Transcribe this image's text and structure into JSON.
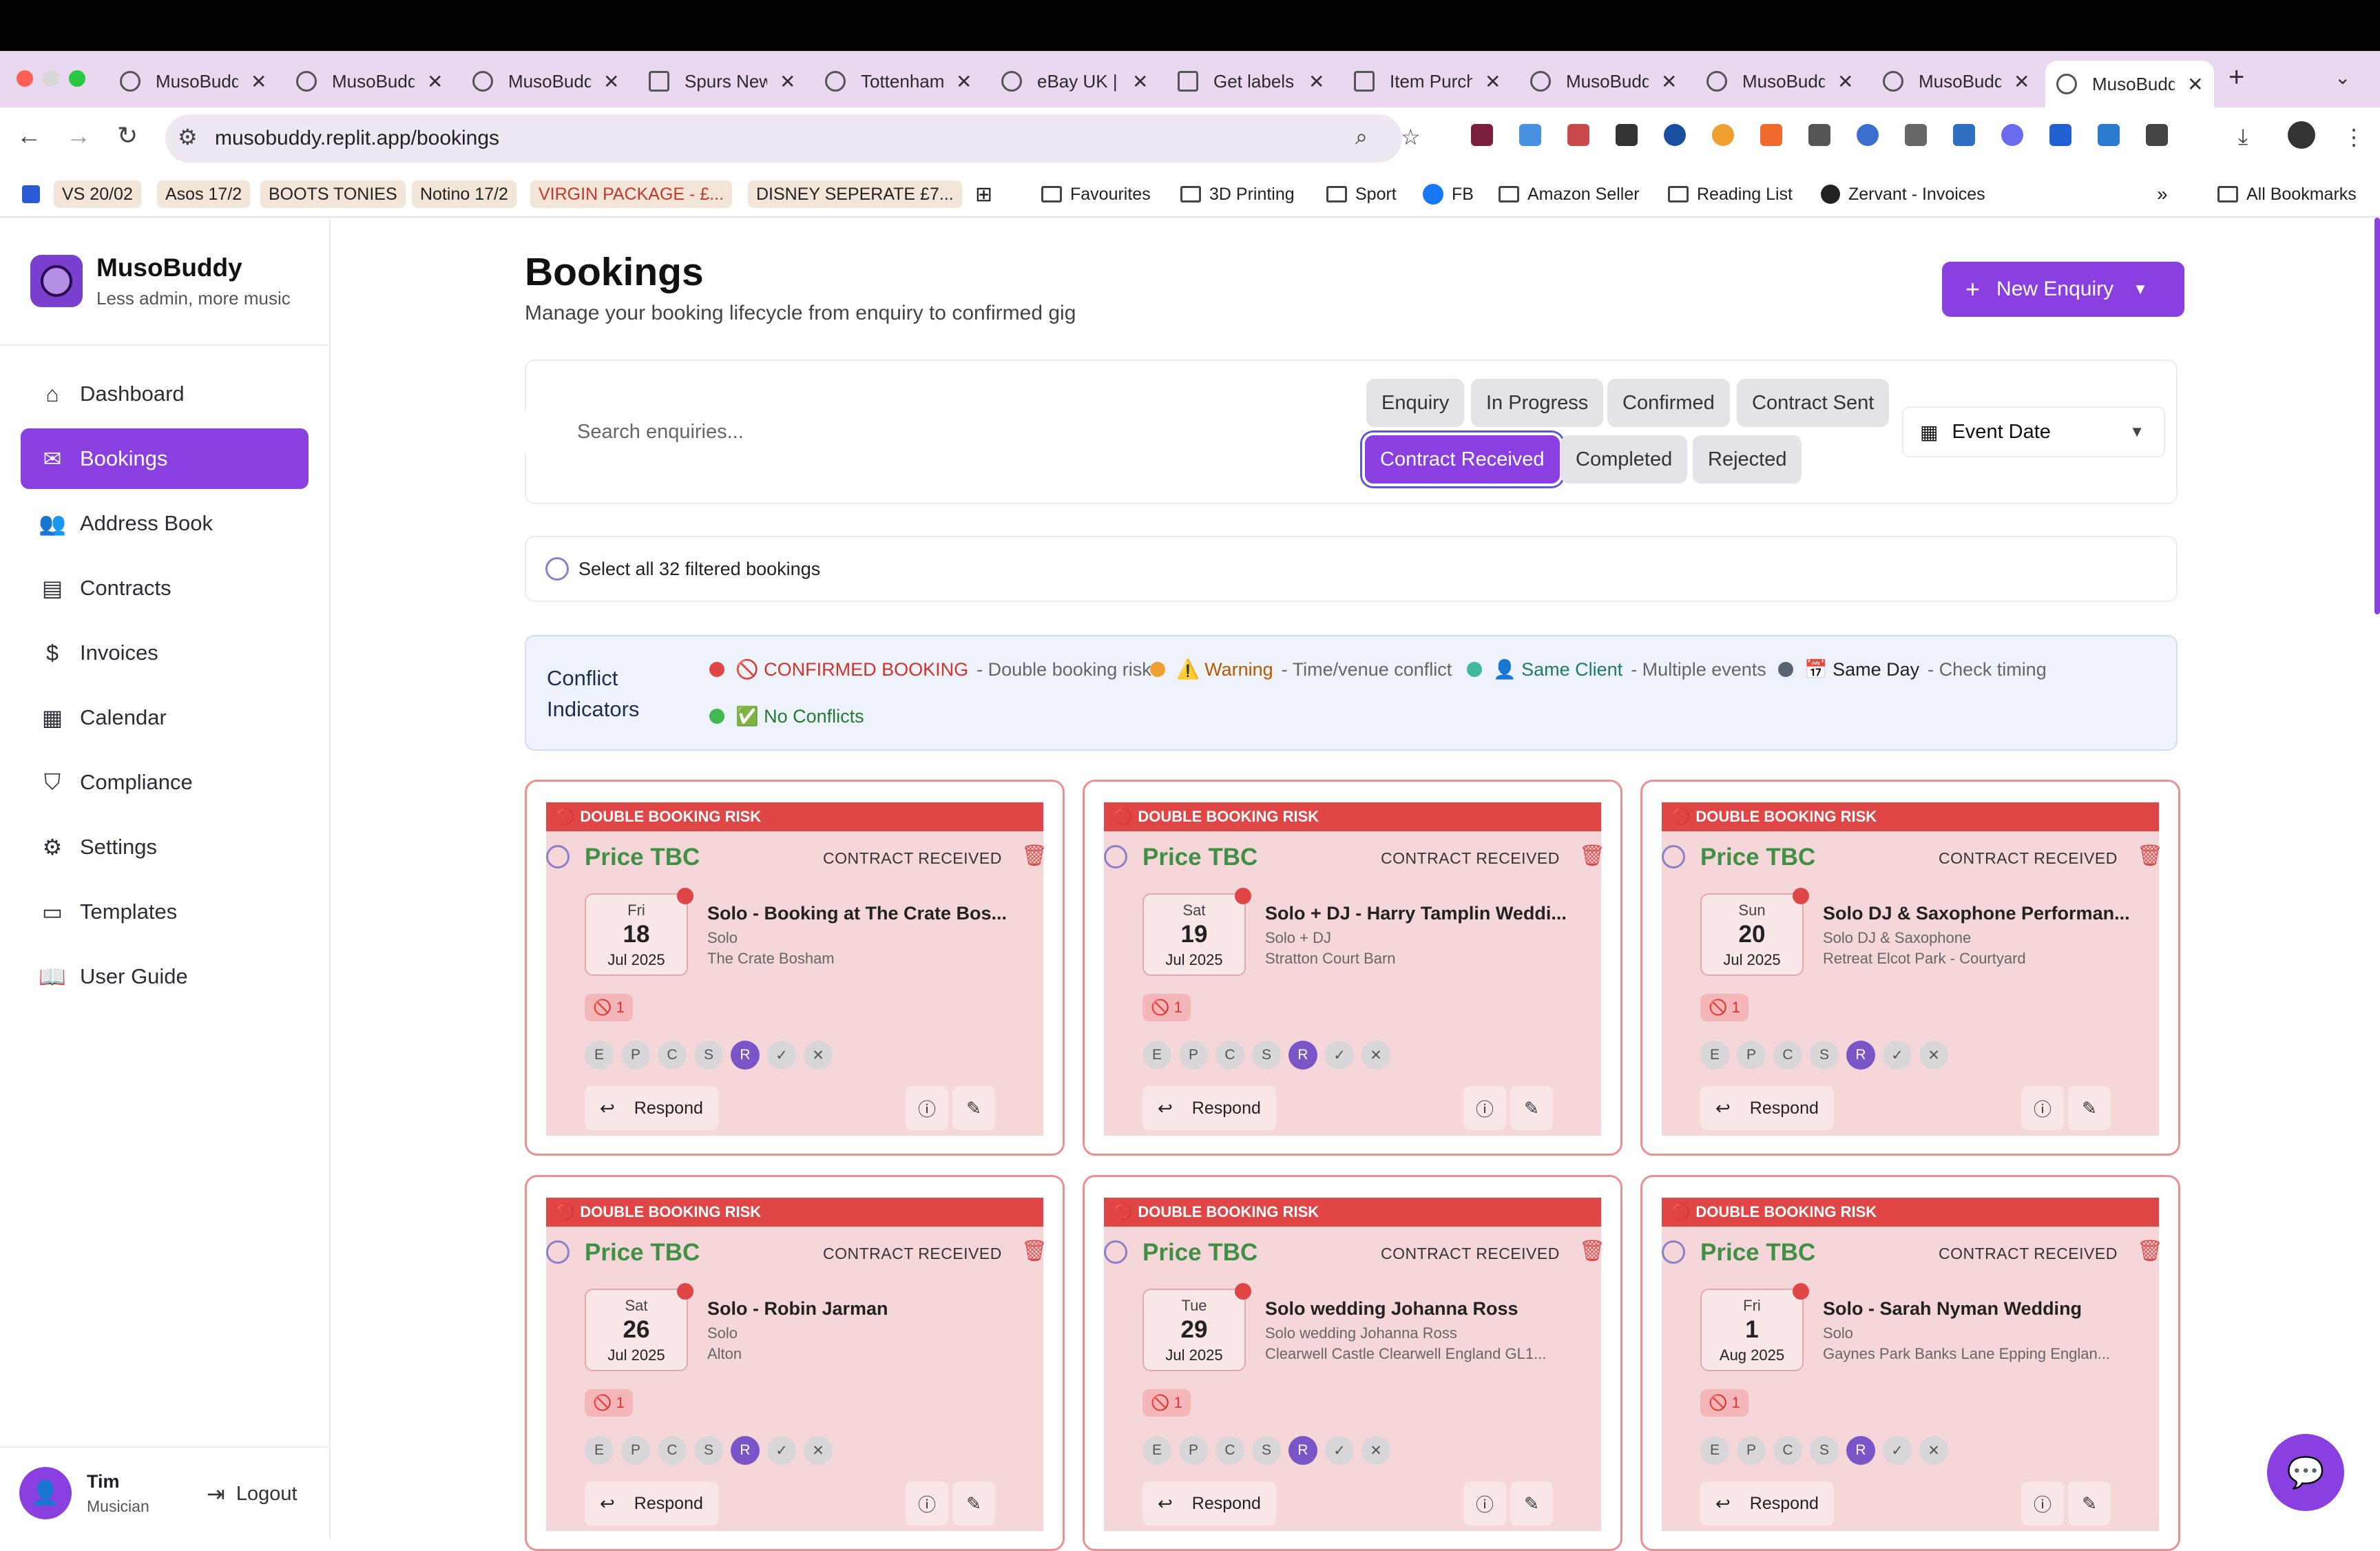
{
  "browser": {
    "tabs": [
      {
        "title": "MusoBuddy"
      },
      {
        "title": "MusoBuddy"
      },
      {
        "title": "MusoBuddy"
      },
      {
        "title": "Spurs News"
      },
      {
        "title": "Tottenham"
      },
      {
        "title": "eBay UK |"
      },
      {
        "title": "Get labels"
      },
      {
        "title": "Item Purch"
      },
      {
        "title": "MusoBuddy"
      },
      {
        "title": "MusoBuddy"
      },
      {
        "title": "MusoBuddy"
      },
      {
        "title": "MusoBuddy"
      }
    ],
    "url": "musobuddy.replit.app/bookings",
    "bookmarks": [
      "VS 20/02",
      "Asos 17/2",
      "BOOTS TONIES",
      "Notino 17/2",
      "VIRGIN PACKAGE - £...",
      "DISNEY SEPERATE £7...",
      "Favourites",
      "3D Printing",
      "Sport",
      "FB",
      "Amazon Seller",
      "Reading List",
      "Zervant - Invoices",
      "All Bookmarks"
    ]
  },
  "app": {
    "name": "MusoBuddy",
    "tagline": "Less admin, more music"
  },
  "nav": [
    {
      "label": "Dashboard",
      "icon": "home-icon"
    },
    {
      "label": "Bookings",
      "icon": "inbox-icon"
    },
    {
      "label": "Address Book",
      "icon": "users-icon"
    },
    {
      "label": "Contracts",
      "icon": "file-icon"
    },
    {
      "label": "Invoices",
      "icon": "dollar-icon"
    },
    {
      "label": "Calendar",
      "icon": "calendar-icon"
    },
    {
      "label": "Compliance",
      "icon": "shield-icon"
    },
    {
      "label": "Settings",
      "icon": "gear-icon"
    },
    {
      "label": "Templates",
      "icon": "message-icon"
    },
    {
      "label": "User Guide",
      "icon": "book-icon"
    }
  ],
  "user": {
    "name": "Tim",
    "role": "Musician",
    "logout": "Logout"
  },
  "page": {
    "title": "Bookings",
    "subtitle": "Manage your booking lifecycle from enquiry to confirmed gig",
    "new_button": "New Enquiry"
  },
  "filters": {
    "search_placeholder": "Search enquiries...",
    "chips": [
      "Enquiry",
      "In Progress",
      "Confirmed",
      "Contract Sent",
      "Contract Received",
      "Completed",
      "Rejected"
    ],
    "active_chip": "Contract Received",
    "sort": "Event Date",
    "select_all": "Select all 32 filtered bookings"
  },
  "conflicts": {
    "title": "Conflict Indicators",
    "items": [
      {
        "label": "🚫 CONFIRMED BOOKING",
        "desc": "- Double booking risk",
        "color": "#e04646"
      },
      {
        "label": "⚠️ Warning",
        "desc": "- Time/venue conflict",
        "color": "#f0a030"
      },
      {
        "label": "👤 Same Client",
        "desc": "- Multiple events",
        "color": "#3fb8a0"
      },
      {
        "label": "📅 Same Day",
        "desc": "- Check timing",
        "color": "#5a6473"
      },
      {
        "label": "✅ No Conflicts",
        "desc": "",
        "color": "#3fb84f"
      }
    ]
  },
  "card_labels": {
    "risk": "DOUBLE BOOKING RISK",
    "price": "Price TBC",
    "status": "CONTRACT RECEIVED",
    "conflict_count": "🚫 1",
    "respond": "Respond",
    "stages": [
      "E",
      "P",
      "C",
      "S",
      "R",
      "✓",
      "✕"
    ]
  },
  "bookings": [
    {
      "dow": "Fri",
      "day": "18",
      "month_year": "Jul 2025",
      "title": "Solo - Booking at The Crate Bos...",
      "type": "Solo",
      "venue": "The Crate Bosham"
    },
    {
      "dow": "Sat",
      "day": "19",
      "month_year": "Jul 2025",
      "title": "Solo + DJ - Harry Tamplin Weddi...",
      "type": "Solo + DJ",
      "venue": "Stratton Court Barn"
    },
    {
      "dow": "Sun",
      "day": "20",
      "month_year": "Jul 2025",
      "title": "Solo DJ & Saxophone Performan...",
      "type": "Solo DJ & Saxophone",
      "venue": "Retreat Elcot Park - Courtyard"
    },
    {
      "dow": "Sat",
      "day": "26",
      "month_year": "Jul 2025",
      "title": "Solo - Robin Jarman",
      "type": "Solo",
      "venue": "Alton"
    },
    {
      "dow": "Tue",
      "day": "29",
      "month_year": "Jul 2025",
      "title": "Solo wedding Johanna Ross",
      "type": "Solo wedding Johanna Ross",
      "venue": "Clearwell Castle Clearwell England GL1..."
    },
    {
      "dow": "Fri",
      "day": "1",
      "month_year": "Aug 2025",
      "title": "Solo - Sarah Nyman Wedding",
      "type": "Solo",
      "venue": "Gaynes Park Banks Lane Epping Englan..."
    }
  ]
}
